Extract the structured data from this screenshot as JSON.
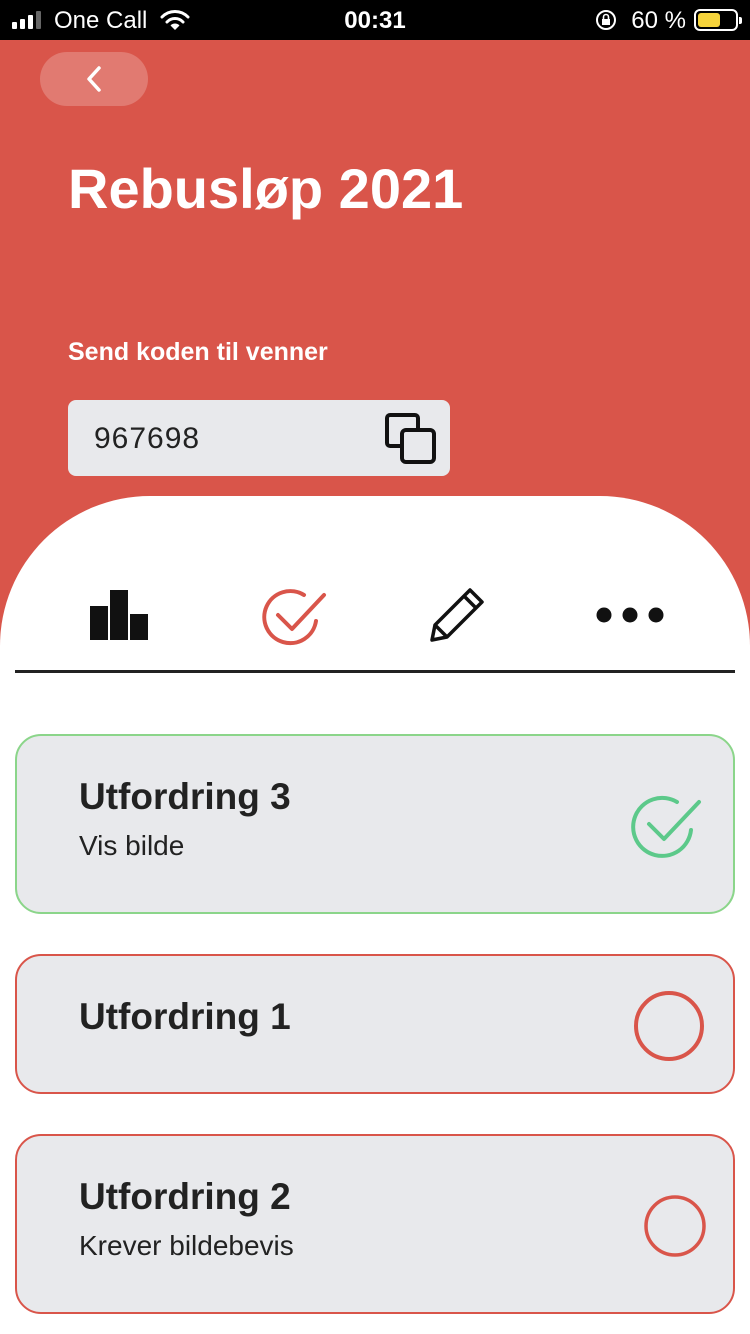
{
  "status_bar": {
    "carrier": "One Call",
    "time": "00:31",
    "battery_percent": "60 %",
    "battery_level": 0.6
  },
  "header": {
    "back_icon": "chevron-left-icon",
    "title": "Rebusløp 2021",
    "subtitle": "Send koden til venner",
    "code": "967698",
    "copy_icon": "copy-icon",
    "background_color": "#d9554a"
  },
  "tabs": [
    {
      "name": "leaderboard",
      "icon": "bar-chart-icon",
      "active": false
    },
    {
      "name": "challenges",
      "icon": "check-circle-icon",
      "active": true
    },
    {
      "name": "edit",
      "icon": "pencil-icon",
      "active": false
    },
    {
      "name": "more",
      "icon": "more-dots-icon",
      "active": false
    }
  ],
  "challenges": [
    {
      "title": "Utfordring 3",
      "subtitle": "Vis bilde",
      "status": "completed",
      "status_icon": "check-circle-icon"
    },
    {
      "title": "Utfordring 1",
      "subtitle": "",
      "status": "pending",
      "status_icon": "empty-circle-icon"
    },
    {
      "title": "Utfordring 2",
      "subtitle": "Krever bildebevis",
      "status": "pending",
      "status_icon": "empty-circle-icon"
    }
  ],
  "colors": {
    "accent": "#d9554a",
    "completed": "#5cc98a",
    "card_background": "#e8e9ec"
  }
}
